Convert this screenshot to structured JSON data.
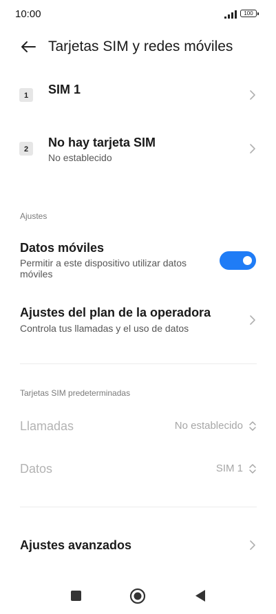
{
  "status_bar": {
    "time": "10:00",
    "battery": "100",
    "icons": [
      "signal-icon",
      "battery-icon"
    ]
  },
  "header": {
    "title": "Tarjetas SIM y redes móviles",
    "back_icon": "arrow-left-icon"
  },
  "sims": [
    {
      "badge": "1",
      "title": "SIM 1",
      "subtitle": ""
    },
    {
      "badge": "2",
      "title": "No hay tarjeta SIM",
      "subtitle": "No establecido"
    }
  ],
  "settings_section": {
    "label": "Ajustes",
    "mobile_data": {
      "title": "Datos móviles",
      "subtitle": "Permitir a este dispositivo utilizar datos móviles",
      "enabled": true
    },
    "carrier_plan": {
      "title": "Ajustes del plan de la operadora",
      "subtitle": "Controla tus llamadas y el uso de datos"
    }
  },
  "default_sims_section": {
    "label": "Tarjetas SIM predeterminadas",
    "calls": {
      "title": "Llamadas",
      "value": "No establecido"
    },
    "data": {
      "title": "Datos",
      "value": "SIM 1"
    }
  },
  "advanced": {
    "title": "Ajustes avanzados"
  },
  "navbar": {
    "icons": [
      "recents-square-icon",
      "home-circle-icon",
      "back-triangle-icon"
    ]
  },
  "colors": {
    "accent": "#1f7cf6",
    "disabled_text": "#b3b3b3",
    "divider": "#ececec"
  }
}
